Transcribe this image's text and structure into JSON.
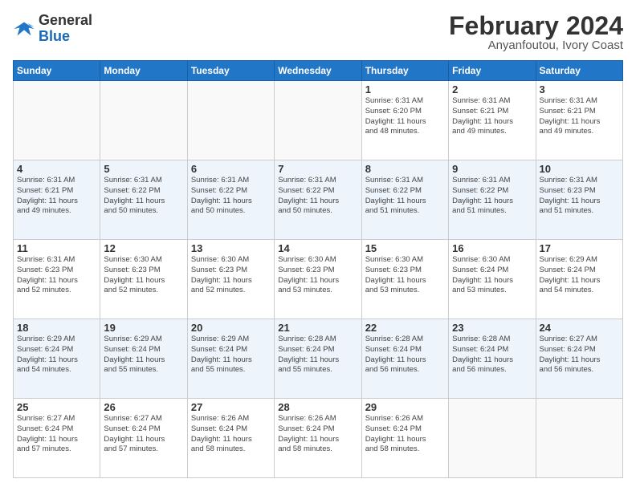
{
  "header": {
    "logo_line1": "General",
    "logo_line2": "Blue",
    "month": "February 2024",
    "location": "Anyanfoutou, Ivory Coast"
  },
  "weekdays": [
    "Sunday",
    "Monday",
    "Tuesday",
    "Wednesday",
    "Thursday",
    "Friday",
    "Saturday"
  ],
  "weeks": [
    [
      {
        "day": "",
        "info": ""
      },
      {
        "day": "",
        "info": ""
      },
      {
        "day": "",
        "info": ""
      },
      {
        "day": "",
        "info": ""
      },
      {
        "day": "1",
        "info": "Sunrise: 6:31 AM\nSunset: 6:20 PM\nDaylight: 11 hours\nand 48 minutes."
      },
      {
        "day": "2",
        "info": "Sunrise: 6:31 AM\nSunset: 6:21 PM\nDaylight: 11 hours\nand 49 minutes."
      },
      {
        "day": "3",
        "info": "Sunrise: 6:31 AM\nSunset: 6:21 PM\nDaylight: 11 hours\nand 49 minutes."
      }
    ],
    [
      {
        "day": "4",
        "info": "Sunrise: 6:31 AM\nSunset: 6:21 PM\nDaylight: 11 hours\nand 49 minutes."
      },
      {
        "day": "5",
        "info": "Sunrise: 6:31 AM\nSunset: 6:22 PM\nDaylight: 11 hours\nand 50 minutes."
      },
      {
        "day": "6",
        "info": "Sunrise: 6:31 AM\nSunset: 6:22 PM\nDaylight: 11 hours\nand 50 minutes."
      },
      {
        "day": "7",
        "info": "Sunrise: 6:31 AM\nSunset: 6:22 PM\nDaylight: 11 hours\nand 50 minutes."
      },
      {
        "day": "8",
        "info": "Sunrise: 6:31 AM\nSunset: 6:22 PM\nDaylight: 11 hours\nand 51 minutes."
      },
      {
        "day": "9",
        "info": "Sunrise: 6:31 AM\nSunset: 6:22 PM\nDaylight: 11 hours\nand 51 minutes."
      },
      {
        "day": "10",
        "info": "Sunrise: 6:31 AM\nSunset: 6:23 PM\nDaylight: 11 hours\nand 51 minutes."
      }
    ],
    [
      {
        "day": "11",
        "info": "Sunrise: 6:31 AM\nSunset: 6:23 PM\nDaylight: 11 hours\nand 52 minutes."
      },
      {
        "day": "12",
        "info": "Sunrise: 6:30 AM\nSunset: 6:23 PM\nDaylight: 11 hours\nand 52 minutes."
      },
      {
        "day": "13",
        "info": "Sunrise: 6:30 AM\nSunset: 6:23 PM\nDaylight: 11 hours\nand 52 minutes."
      },
      {
        "day": "14",
        "info": "Sunrise: 6:30 AM\nSunset: 6:23 PM\nDaylight: 11 hours\nand 53 minutes."
      },
      {
        "day": "15",
        "info": "Sunrise: 6:30 AM\nSunset: 6:23 PM\nDaylight: 11 hours\nand 53 minutes."
      },
      {
        "day": "16",
        "info": "Sunrise: 6:30 AM\nSunset: 6:24 PM\nDaylight: 11 hours\nand 53 minutes."
      },
      {
        "day": "17",
        "info": "Sunrise: 6:29 AM\nSunset: 6:24 PM\nDaylight: 11 hours\nand 54 minutes."
      }
    ],
    [
      {
        "day": "18",
        "info": "Sunrise: 6:29 AM\nSunset: 6:24 PM\nDaylight: 11 hours\nand 54 minutes."
      },
      {
        "day": "19",
        "info": "Sunrise: 6:29 AM\nSunset: 6:24 PM\nDaylight: 11 hours\nand 55 minutes."
      },
      {
        "day": "20",
        "info": "Sunrise: 6:29 AM\nSunset: 6:24 PM\nDaylight: 11 hours\nand 55 minutes."
      },
      {
        "day": "21",
        "info": "Sunrise: 6:28 AM\nSunset: 6:24 PM\nDaylight: 11 hours\nand 55 minutes."
      },
      {
        "day": "22",
        "info": "Sunrise: 6:28 AM\nSunset: 6:24 PM\nDaylight: 11 hours\nand 56 minutes."
      },
      {
        "day": "23",
        "info": "Sunrise: 6:28 AM\nSunset: 6:24 PM\nDaylight: 11 hours\nand 56 minutes."
      },
      {
        "day": "24",
        "info": "Sunrise: 6:27 AM\nSunset: 6:24 PM\nDaylight: 11 hours\nand 56 minutes."
      }
    ],
    [
      {
        "day": "25",
        "info": "Sunrise: 6:27 AM\nSunset: 6:24 PM\nDaylight: 11 hours\nand 57 minutes."
      },
      {
        "day": "26",
        "info": "Sunrise: 6:27 AM\nSunset: 6:24 PM\nDaylight: 11 hours\nand 57 minutes."
      },
      {
        "day": "27",
        "info": "Sunrise: 6:26 AM\nSunset: 6:24 PM\nDaylight: 11 hours\nand 58 minutes."
      },
      {
        "day": "28",
        "info": "Sunrise: 6:26 AM\nSunset: 6:24 PM\nDaylight: 11 hours\nand 58 minutes."
      },
      {
        "day": "29",
        "info": "Sunrise: 6:26 AM\nSunset: 6:24 PM\nDaylight: 11 hours\nand 58 minutes."
      },
      {
        "day": "",
        "info": ""
      },
      {
        "day": "",
        "info": ""
      }
    ]
  ],
  "row_colors": [
    "row-bg-1",
    "row-bg-2",
    "row-bg-1",
    "row-bg-2",
    "row-bg-1"
  ]
}
